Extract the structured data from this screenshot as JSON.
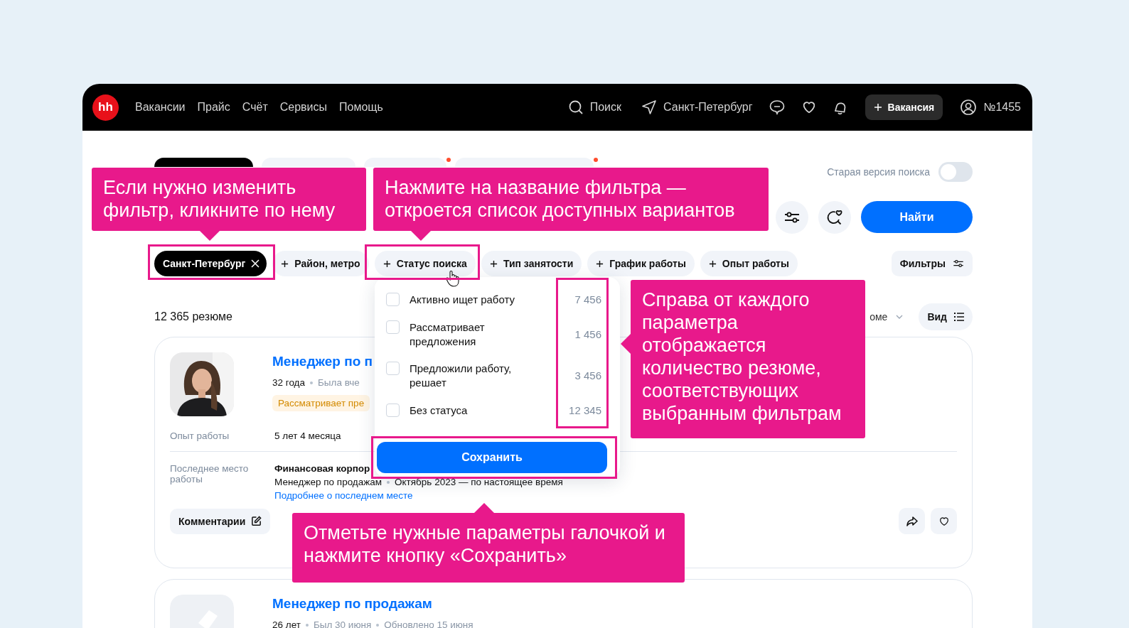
{
  "header": {
    "logo": "hh",
    "nav": [
      "Вакансии",
      "Прайс",
      "Счёт",
      "Сервисы",
      "Помощь"
    ],
    "search": "Поиск",
    "city": "Санкт-Петербург",
    "post_button": "Вакансия",
    "account": "№1455"
  },
  "tabs": [
    {
      "selected": true,
      "dot": false
    },
    {
      "selected": false,
      "dot": false
    },
    {
      "selected": false,
      "dot": true
    },
    {
      "selected": false,
      "dot": true
    }
  ],
  "old_search": {
    "label": "Старая версия поиска",
    "on": false
  },
  "find_button": "Найти",
  "chips": [
    {
      "label": "Санкт-Петербург",
      "selected": true
    },
    {
      "label": "Район, метро",
      "selected": false
    },
    {
      "label": "Статус поиска",
      "selected": false
    },
    {
      "label": "Тип занятости",
      "selected": false
    },
    {
      "label": "График работы",
      "selected": false
    },
    {
      "label": "Опыт работы",
      "selected": false
    }
  ],
  "filters_button": "Фильтры",
  "results_count": "12 365 резюме",
  "sort": "оме",
  "view_button": "Вид",
  "dropdown": {
    "options": [
      {
        "label": "Активно ищет работу",
        "count": "7 456",
        "checked": false
      },
      {
        "label": "Рассматривает предложения",
        "count": "1 456",
        "checked": false
      },
      {
        "label": "Предложили работу, решает",
        "count": "3 456",
        "checked": false
      },
      {
        "label": "Без статуса",
        "count": "12 345",
        "checked": false
      }
    ],
    "save": "Сохранить"
  },
  "cards": [
    {
      "title": "Менеджер по п",
      "age": "32 года",
      "seen": "Была вче",
      "status": "Рассматривает пре",
      "experience_label": "Опыт работы",
      "experience": "5 лет 4 месяца",
      "last_job_label": "Последнее место работы",
      "company": "Финансовая корпор",
      "position": "Менеджер по продажам",
      "period": "Октябрь 2023 — по настоящее время",
      "more": "Подробнее о последнем месте",
      "comments": "Комментарии"
    },
    {
      "kind": "placeholder",
      "title": "Менеджер по продажам",
      "age": "26 лет",
      "seen": "Был 30 июня",
      "updated": "Обновлено 15 июня"
    }
  ],
  "callouts": [
    {
      "text": "Если нужно изменить фильтр, кликните по нему",
      "kind": "down"
    },
    {
      "text": "Нажмите на название фильтра — откроется список доступных вариантов",
      "kind": "down"
    },
    {
      "text": "Справа от каждого параметра отображается количество резюме, соответствующих выбранным фильтрам",
      "kind": "left"
    },
    {
      "text": "Отметьте нужные параметры галочкой и нажмите кнопку «Сохранить»",
      "kind": "up"
    }
  ]
}
